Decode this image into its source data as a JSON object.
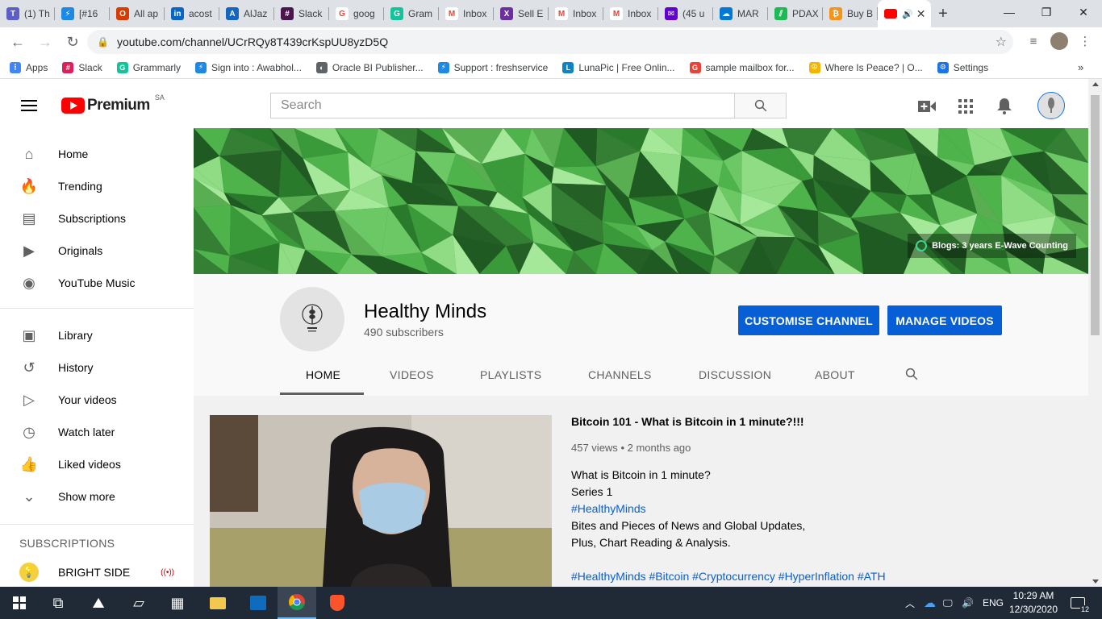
{
  "browser": {
    "tabs": [
      {
        "label": "(1) Th",
        "color": "#5b5fc7",
        "glyph": "T"
      },
      {
        "label": "[#16",
        "color": "#1e88e5",
        "glyph": "⚡"
      },
      {
        "label": "All ap",
        "color": "#d83b01",
        "glyph": "O"
      },
      {
        "label": "acost",
        "color": "#0a66c2",
        "glyph": "in"
      },
      {
        "label": "AlJaz",
        "color": "#1565c0",
        "glyph": "A"
      },
      {
        "label": "Slack",
        "color": "#4a154b",
        "glyph": "#"
      },
      {
        "label": "goog",
        "color": "#ffffff",
        "glyph": "G"
      },
      {
        "label": "Gram",
        "color": "#15c39a",
        "glyph": "G"
      },
      {
        "label": "Inbox",
        "color": "#ffffff",
        "glyph": "M"
      },
      {
        "label": "Sell E",
        "color": "#6b2fa0",
        "glyph": "X"
      },
      {
        "label": "Inbox",
        "color": "#ffffff",
        "glyph": "M"
      },
      {
        "label": "Inbox",
        "color": "#ffffff",
        "glyph": "M"
      },
      {
        "label": "(45 u",
        "color": "#6001d2",
        "glyph": "✉"
      },
      {
        "label": "MAR",
        "color": "#0078d4",
        "glyph": "☁"
      },
      {
        "label": "PDAX",
        "color": "#1db954",
        "glyph": "⫽"
      },
      {
        "label": "Buy B",
        "color": "#f7931a",
        "glyph": "₿"
      }
    ],
    "active_tab": {
      "color": "#ff0000"
    },
    "url": "youtube.com/channel/UCrRQy8T439crKspUU8yzD5Q",
    "bookmarks": [
      {
        "label": "Apps",
        "color": "#4285f4",
        "glyph": "⋮"
      },
      {
        "label": "Slack",
        "color": "#e01e5a",
        "glyph": "#"
      },
      {
        "label": "Grammarly",
        "color": "#15c39a",
        "glyph": "G"
      },
      {
        "label": "Sign into : Awabhol...",
        "color": "#1e88e5",
        "glyph": "⚡"
      },
      {
        "label": "Oracle BI Publisher...",
        "color": "#5f6368",
        "glyph": "◐"
      },
      {
        "label": "Support : freshservice",
        "color": "#1e88e5",
        "glyph": "⚡"
      },
      {
        "label": "LunaPic | Free Onlin...",
        "color": "#0a84c6",
        "glyph": "L"
      },
      {
        "label": "sample mailbox for...",
        "color": "#ea4335",
        "glyph": "G"
      },
      {
        "label": "Where Is Peace? | O...",
        "color": "#f4b400",
        "glyph": "☮"
      },
      {
        "label": "Settings",
        "color": "#1a73e8",
        "glyph": "⚙"
      }
    ]
  },
  "masthead": {
    "logo_word": "Premium",
    "region": "SA",
    "search_placeholder": "Search"
  },
  "sidebar": {
    "primary": [
      {
        "label": "Home",
        "icon": "home-icon",
        "glyph": "⌂"
      },
      {
        "label": "Trending",
        "icon": "flame-icon",
        "glyph": "🔥"
      },
      {
        "label": "Subscriptions",
        "icon": "subscriptions-icon",
        "glyph": "▤"
      },
      {
        "label": "Originals",
        "icon": "originals-icon",
        "glyph": "▶"
      },
      {
        "label": "YouTube Music",
        "icon": "music-icon",
        "glyph": "◉"
      }
    ],
    "secondary": [
      {
        "label": "Library",
        "icon": "library-icon",
        "glyph": "▣"
      },
      {
        "label": "History",
        "icon": "history-icon",
        "glyph": "↺"
      },
      {
        "label": "Your videos",
        "icon": "your-videos-icon",
        "glyph": "▷"
      },
      {
        "label": "Watch later",
        "icon": "clock-icon",
        "glyph": "◷"
      },
      {
        "label": "Liked videos",
        "icon": "thumbs-up-icon",
        "glyph": "👍"
      },
      {
        "label": "Show more",
        "icon": "chevron-down-icon",
        "glyph": "⌄"
      }
    ],
    "subscriptions_heading": "SUBSCRIPTIONS",
    "subscriptions": [
      {
        "label": "BRIGHT SIDE",
        "live": "((•))"
      }
    ]
  },
  "banner": {
    "link_label": "Blogs: 3 years E-Wave Counting"
  },
  "channel": {
    "name": "Healthy Minds",
    "subscribers": "490 subscribers",
    "customise_label": "CUSTOMISE CHANNEL",
    "manage_label": "MANAGE VIDEOS",
    "tabs": [
      "HOME",
      "VIDEOS",
      "PLAYLISTS",
      "CHANNELS",
      "DISCUSSION",
      "ABOUT"
    ],
    "active_tab": "HOME"
  },
  "featured": {
    "title": "Bitcoin 101 - What is Bitcoin in 1 minute?!!!",
    "views": "457 views",
    "age": "2 months ago",
    "description": [
      {
        "text": "What is Bitcoin in 1 minute?",
        "hash": false
      },
      {
        "text": "Series 1",
        "hash": false
      },
      {
        "text": "#HealthyMinds",
        "hash": true
      },
      {
        "text": "Bites and Pieces of News and Global Updates,",
        "hash": false
      },
      {
        "text": "Plus, Chart Reading & Analysis.",
        "hash": false
      },
      {
        "text": "",
        "hash": false
      },
      {
        "text": "#HealthyMinds #Bitcoin #Cryptocurrency #HyperInflation #ATH",
        "hash": true
      }
    ]
  },
  "taskbar": {
    "language": "ENG",
    "time": "10:29 AM",
    "date": "12/30/2020",
    "notifications": "12"
  },
  "colors": {
    "accent_blue": "#065fd4",
    "youtube_red": "#ff0000",
    "banner_green": "#3fa03f"
  }
}
